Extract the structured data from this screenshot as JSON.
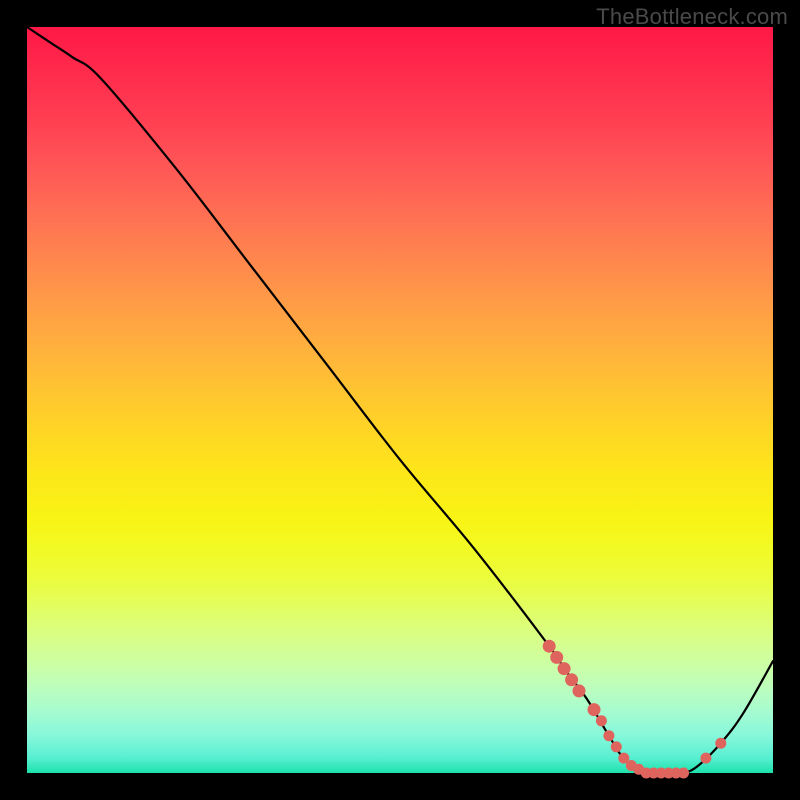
{
  "watermark": "TheBottleneck.com",
  "chart_data": {
    "type": "line",
    "title": "",
    "xlabel": "",
    "ylabel": "",
    "xlim": [
      0,
      100
    ],
    "ylim": [
      0,
      100
    ],
    "series": [
      {
        "name": "bottleneck-curve",
        "x": [
          0,
          3,
          6,
          10,
          20,
          30,
          40,
          50,
          60,
          70,
          72,
          75,
          78,
          80,
          83,
          86,
          88,
          90,
          93,
          96,
          100
        ],
        "y": [
          100,
          98,
          96,
          93,
          81,
          68,
          55,
          42,
          30,
          17,
          14,
          10,
          5,
          2,
          0,
          0,
          0,
          1,
          4,
          8,
          15
        ]
      }
    ],
    "markers": {
      "name": "highlight-points",
      "x": [
        70,
        71,
        72,
        73,
        74,
        76,
        77,
        78,
        79,
        80,
        81,
        82,
        83,
        84,
        85,
        86,
        87,
        88,
        91,
        93
      ],
      "y": [
        17,
        15.5,
        14,
        12.5,
        11,
        8.5,
        7,
        5,
        3.5,
        2,
        1,
        0.5,
        0,
        0,
        0,
        0,
        0,
        0,
        2,
        4
      ]
    },
    "gradient_stops": [
      {
        "pos": 0,
        "color": "#ff1846"
      },
      {
        "pos": 50,
        "color": "#ffc233"
      },
      {
        "pos": 70,
        "color": "#f2fa25"
      },
      {
        "pos": 90,
        "color": "#a4fbd1"
      },
      {
        "pos": 100,
        "color": "#1ce2ac"
      }
    ]
  }
}
